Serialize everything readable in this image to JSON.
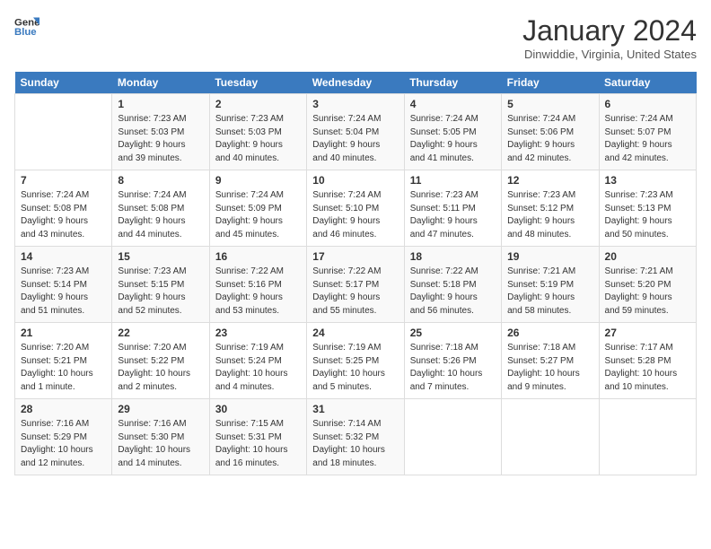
{
  "header": {
    "logo_line1": "General",
    "logo_line2": "Blue",
    "month_title": "January 2024",
    "location": "Dinwiddie, Virginia, United States"
  },
  "days_of_week": [
    "Sunday",
    "Monday",
    "Tuesday",
    "Wednesday",
    "Thursday",
    "Friday",
    "Saturday"
  ],
  "weeks": [
    [
      {
        "day": "",
        "info": ""
      },
      {
        "day": "1",
        "info": "Sunrise: 7:23 AM\nSunset: 5:03 PM\nDaylight: 9 hours\nand 39 minutes."
      },
      {
        "day": "2",
        "info": "Sunrise: 7:23 AM\nSunset: 5:03 PM\nDaylight: 9 hours\nand 40 minutes."
      },
      {
        "day": "3",
        "info": "Sunrise: 7:24 AM\nSunset: 5:04 PM\nDaylight: 9 hours\nand 40 minutes."
      },
      {
        "day": "4",
        "info": "Sunrise: 7:24 AM\nSunset: 5:05 PM\nDaylight: 9 hours\nand 41 minutes."
      },
      {
        "day": "5",
        "info": "Sunrise: 7:24 AM\nSunset: 5:06 PM\nDaylight: 9 hours\nand 42 minutes."
      },
      {
        "day": "6",
        "info": "Sunrise: 7:24 AM\nSunset: 5:07 PM\nDaylight: 9 hours\nand 42 minutes."
      }
    ],
    [
      {
        "day": "7",
        "info": "Sunrise: 7:24 AM\nSunset: 5:08 PM\nDaylight: 9 hours\nand 43 minutes."
      },
      {
        "day": "8",
        "info": "Sunrise: 7:24 AM\nSunset: 5:08 PM\nDaylight: 9 hours\nand 44 minutes."
      },
      {
        "day": "9",
        "info": "Sunrise: 7:24 AM\nSunset: 5:09 PM\nDaylight: 9 hours\nand 45 minutes."
      },
      {
        "day": "10",
        "info": "Sunrise: 7:24 AM\nSunset: 5:10 PM\nDaylight: 9 hours\nand 46 minutes."
      },
      {
        "day": "11",
        "info": "Sunrise: 7:23 AM\nSunset: 5:11 PM\nDaylight: 9 hours\nand 47 minutes."
      },
      {
        "day": "12",
        "info": "Sunrise: 7:23 AM\nSunset: 5:12 PM\nDaylight: 9 hours\nand 48 minutes."
      },
      {
        "day": "13",
        "info": "Sunrise: 7:23 AM\nSunset: 5:13 PM\nDaylight: 9 hours\nand 50 minutes."
      }
    ],
    [
      {
        "day": "14",
        "info": "Sunrise: 7:23 AM\nSunset: 5:14 PM\nDaylight: 9 hours\nand 51 minutes."
      },
      {
        "day": "15",
        "info": "Sunrise: 7:23 AM\nSunset: 5:15 PM\nDaylight: 9 hours\nand 52 minutes."
      },
      {
        "day": "16",
        "info": "Sunrise: 7:22 AM\nSunset: 5:16 PM\nDaylight: 9 hours\nand 53 minutes."
      },
      {
        "day": "17",
        "info": "Sunrise: 7:22 AM\nSunset: 5:17 PM\nDaylight: 9 hours\nand 55 minutes."
      },
      {
        "day": "18",
        "info": "Sunrise: 7:22 AM\nSunset: 5:18 PM\nDaylight: 9 hours\nand 56 minutes."
      },
      {
        "day": "19",
        "info": "Sunrise: 7:21 AM\nSunset: 5:19 PM\nDaylight: 9 hours\nand 58 minutes."
      },
      {
        "day": "20",
        "info": "Sunrise: 7:21 AM\nSunset: 5:20 PM\nDaylight: 9 hours\nand 59 minutes."
      }
    ],
    [
      {
        "day": "21",
        "info": "Sunrise: 7:20 AM\nSunset: 5:21 PM\nDaylight: 10 hours\nand 1 minute."
      },
      {
        "day": "22",
        "info": "Sunrise: 7:20 AM\nSunset: 5:22 PM\nDaylight: 10 hours\nand 2 minutes."
      },
      {
        "day": "23",
        "info": "Sunrise: 7:19 AM\nSunset: 5:24 PM\nDaylight: 10 hours\nand 4 minutes."
      },
      {
        "day": "24",
        "info": "Sunrise: 7:19 AM\nSunset: 5:25 PM\nDaylight: 10 hours\nand 5 minutes."
      },
      {
        "day": "25",
        "info": "Sunrise: 7:18 AM\nSunset: 5:26 PM\nDaylight: 10 hours\nand 7 minutes."
      },
      {
        "day": "26",
        "info": "Sunrise: 7:18 AM\nSunset: 5:27 PM\nDaylight: 10 hours\nand 9 minutes."
      },
      {
        "day": "27",
        "info": "Sunrise: 7:17 AM\nSunset: 5:28 PM\nDaylight: 10 hours\nand 10 minutes."
      }
    ],
    [
      {
        "day": "28",
        "info": "Sunrise: 7:16 AM\nSunset: 5:29 PM\nDaylight: 10 hours\nand 12 minutes."
      },
      {
        "day": "29",
        "info": "Sunrise: 7:16 AM\nSunset: 5:30 PM\nDaylight: 10 hours\nand 14 minutes."
      },
      {
        "day": "30",
        "info": "Sunrise: 7:15 AM\nSunset: 5:31 PM\nDaylight: 10 hours\nand 16 minutes."
      },
      {
        "day": "31",
        "info": "Sunrise: 7:14 AM\nSunset: 5:32 PM\nDaylight: 10 hours\nand 18 minutes."
      },
      {
        "day": "",
        "info": ""
      },
      {
        "day": "",
        "info": ""
      },
      {
        "day": "",
        "info": ""
      }
    ]
  ]
}
